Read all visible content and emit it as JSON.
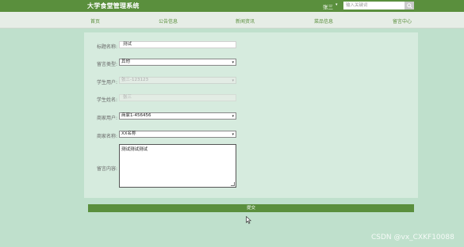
{
  "header": {
    "app_title": "大学食堂管理系统",
    "user_name": "张三",
    "user_caret": "▾",
    "search_placeholder": "输入关键词"
  },
  "nav": {
    "items": [
      {
        "label": "首页"
      },
      {
        "label": "公告信息"
      },
      {
        "label": "新闻资讯"
      },
      {
        "label": "菜品信息"
      },
      {
        "label": "留言中心"
      }
    ]
  },
  "form": {
    "title_label": "标题名称:",
    "title_value": "测试",
    "type_label": "留言类型:",
    "type_value": "其他",
    "student_user_label": "学生用户:",
    "student_user_value": "张三-123123",
    "student_name_label": "学生姓名:",
    "student_name_value": "张三",
    "merchant_user_label": "商家用户:",
    "merchant_user_value": "商家1-456456",
    "merchant_name_label": "商家名称:",
    "merchant_name_value": "XX名称",
    "content_label": "留言内容:",
    "content_value": "测试测试测试",
    "select_caret": "▾"
  },
  "submit_label": "提交",
  "watermark": "CSDN @vx_CXKF10088"
}
